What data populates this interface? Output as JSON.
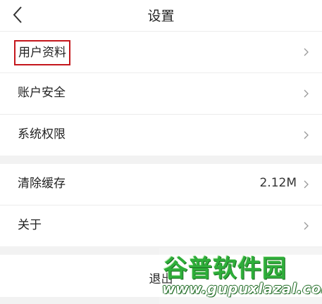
{
  "header": {
    "title": "设置",
    "back_icon": "chevron-left-icon"
  },
  "group1": {
    "items": [
      {
        "label": "用户资料"
      },
      {
        "label": "账户安全"
      },
      {
        "label": "系统权限"
      }
    ]
  },
  "group2": {
    "items": [
      {
        "label": "清除缓存",
        "value": "2.12M"
      },
      {
        "label": "关于"
      }
    ]
  },
  "logout": {
    "label": "退出"
  },
  "watermark": {
    "title": "谷普软件园",
    "url": "www.gupuxlazal.com"
  },
  "colors": {
    "highlight_border": "#c4161c",
    "watermark_green": "#2eae3a"
  }
}
